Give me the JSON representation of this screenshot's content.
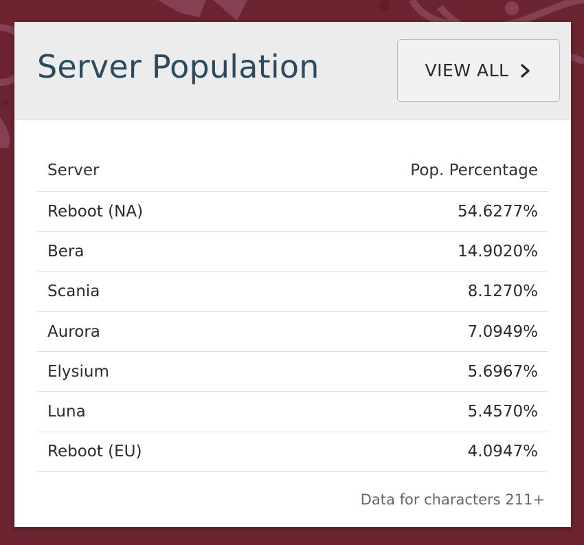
{
  "colors": {
    "background": "#6d2431",
    "card": "#ffffff",
    "header_bg": "#ececec",
    "title": "#2b4a5e",
    "button_bg": "#f1f1f1",
    "button_border": "#bdbdbd"
  },
  "card": {
    "title": "Server Population",
    "view_all_label": "VIEW ALL",
    "view_all_icon": "chevron-right-icon"
  },
  "table": {
    "headers": {
      "server": "Server",
      "pop": "Pop. Percentage"
    },
    "rows": [
      {
        "server": "Reboot (NA)",
        "pop": "54.6277%"
      },
      {
        "server": "Bera",
        "pop": "14.9020%"
      },
      {
        "server": "Scania",
        "pop": "8.1270%"
      },
      {
        "server": "Aurora",
        "pop": "7.0949%"
      },
      {
        "server": "Elysium",
        "pop": "5.6967%"
      },
      {
        "server": "Luna",
        "pop": "5.4570%"
      },
      {
        "server": "Reboot (EU)",
        "pop": "4.0947%"
      }
    ]
  },
  "footnote": "Data for characters 211+"
}
